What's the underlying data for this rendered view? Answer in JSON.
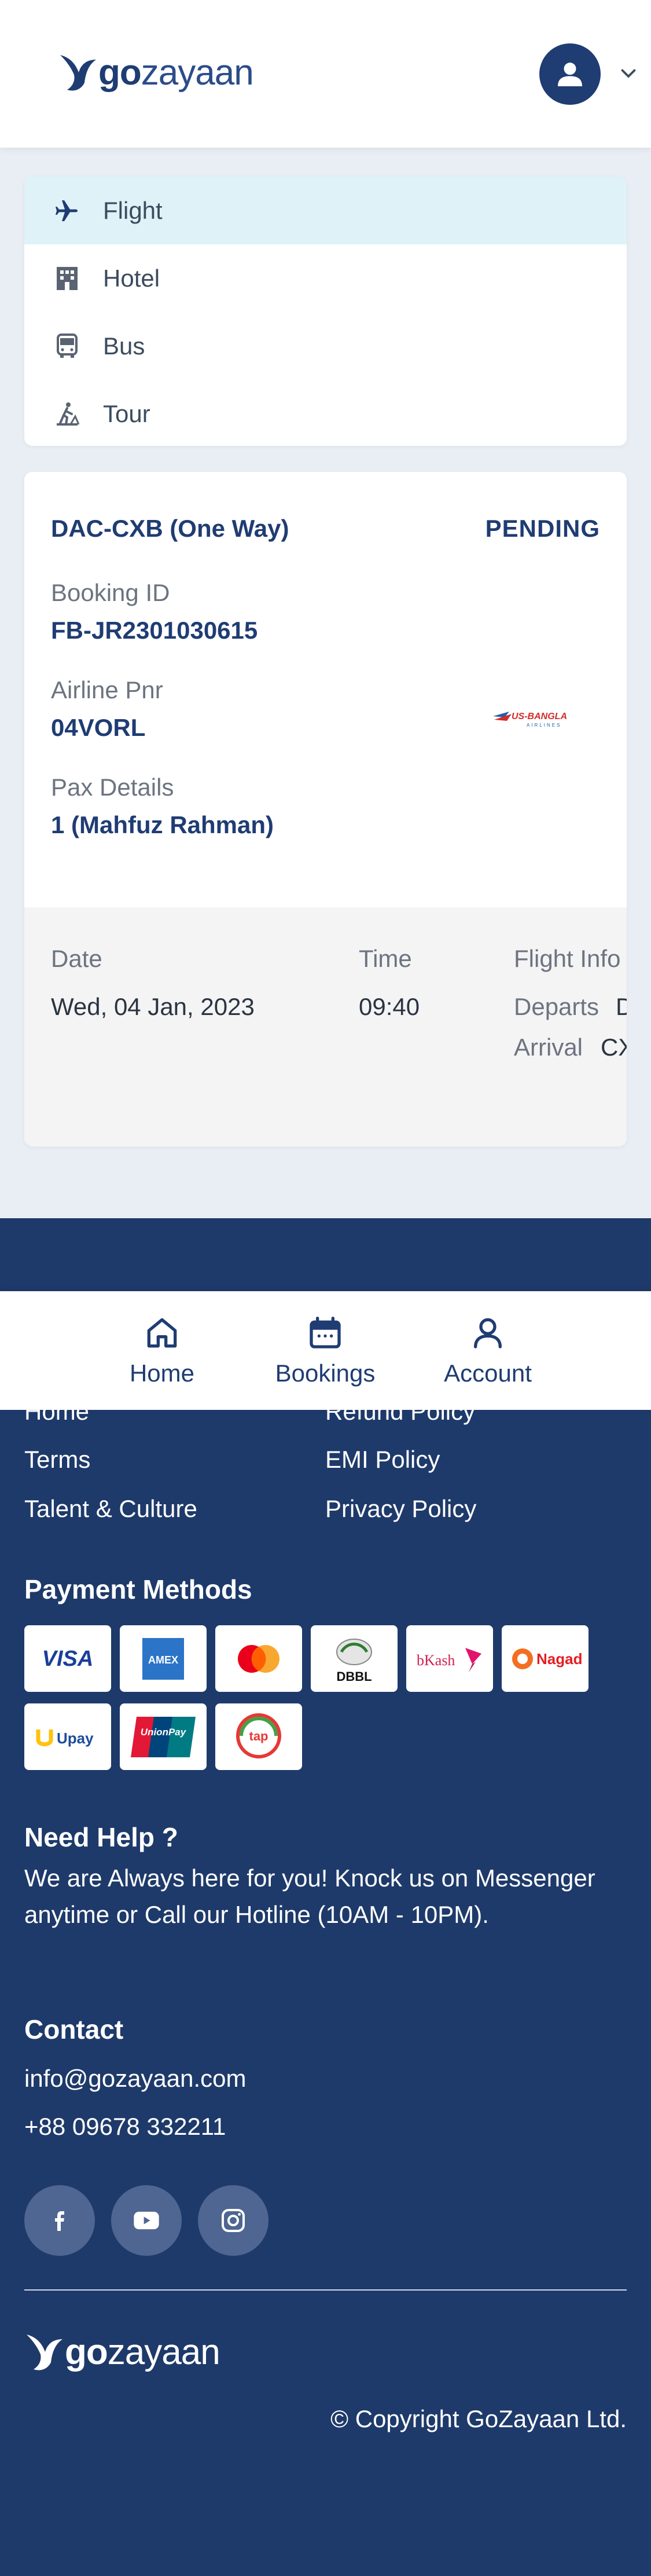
{
  "header": {
    "logo_go": "go",
    "logo_zayaan": "zayaan"
  },
  "services": [
    {
      "label": "Flight",
      "icon": "plane-icon",
      "active": true
    },
    {
      "label": "Hotel",
      "icon": "hotel-icon",
      "active": false
    },
    {
      "label": "Bus",
      "icon": "bus-icon",
      "active": false
    },
    {
      "label": "Tour",
      "icon": "tour-icon",
      "active": false
    }
  ],
  "booking": {
    "route": "DAC-CXB (One Way)",
    "status": "PENDING",
    "booking_id_label": "Booking ID",
    "booking_id": "FB-JR2301030615",
    "pnr_label": "Airline Pnr",
    "pnr": "04VORL",
    "airline_logo_text": "US-BANGLA",
    "airline_logo_sub": "AIRLINES",
    "pax_label": "Pax Details",
    "pax": "1 (Mahfuz Rahman)",
    "date_label": "Date",
    "date": "Wed, 04 Jan, 2023",
    "time_label": "Time",
    "time": "09:40",
    "flight_info_label": "Flight Info",
    "departs_label": "Departs",
    "departs": "D",
    "arrival_label": "Arrival",
    "arrival": "CX"
  },
  "footer": {
    "links_left": [
      "Home",
      "Terms",
      "Talent & Culture"
    ],
    "links_right": [
      "Refund Policy",
      "EMI Policy",
      "Privacy Policy"
    ],
    "payment_heading": "Payment Methods",
    "payment_methods": [
      "VISA",
      "AMEX",
      "Mastercard",
      "DBBL",
      "bKash",
      "Nagad",
      "Upay",
      "UnionPay",
      "tap"
    ],
    "help_heading": "Need Help ?",
    "help_text": "We are Always here for you! Knock us on Messenger anytime or Call our Hotline (10AM - 10PM).",
    "contact_heading": "Contact",
    "email": "info@gozayaan.com",
    "phone": "+88 09678 332211",
    "copyright": "© Copyright GoZayaan Ltd."
  },
  "bottom_nav": [
    {
      "label": "Home",
      "icon": "home-icon"
    },
    {
      "label": "Bookings",
      "icon": "calendar-icon"
    },
    {
      "label": "Account",
      "icon": "user-icon"
    }
  ],
  "colors": {
    "brand_navy": "#1e3a6a",
    "active_menu_bg": "#dff2f8"
  }
}
